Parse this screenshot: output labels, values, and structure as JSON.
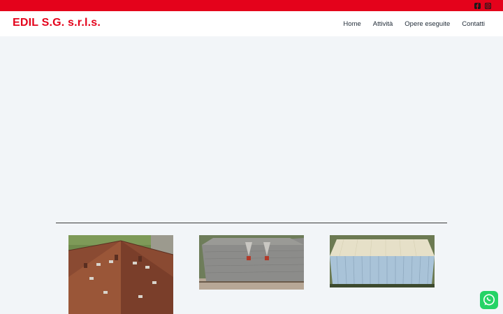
{
  "brand": {
    "name": "EDIL S.G. s.r.l.s.",
    "color": "#e4021b"
  },
  "social": [
    {
      "icon": "facebook-icon"
    },
    {
      "icon": "instagram-icon"
    }
  ],
  "nav": {
    "items": [
      {
        "label": "Home"
      },
      {
        "label": "Attività"
      },
      {
        "label": "Opere eseguite"
      },
      {
        "label": "Contatti"
      }
    ]
  },
  "gallery": [
    {
      "icon": "roof-terracotta-photo"
    },
    {
      "icon": "roof-grey-tiles-photo"
    },
    {
      "icon": "roof-metal-sheet-photo"
    }
  ],
  "floating": {
    "icon": "whatsapp-icon",
    "color": "#25d366"
  }
}
